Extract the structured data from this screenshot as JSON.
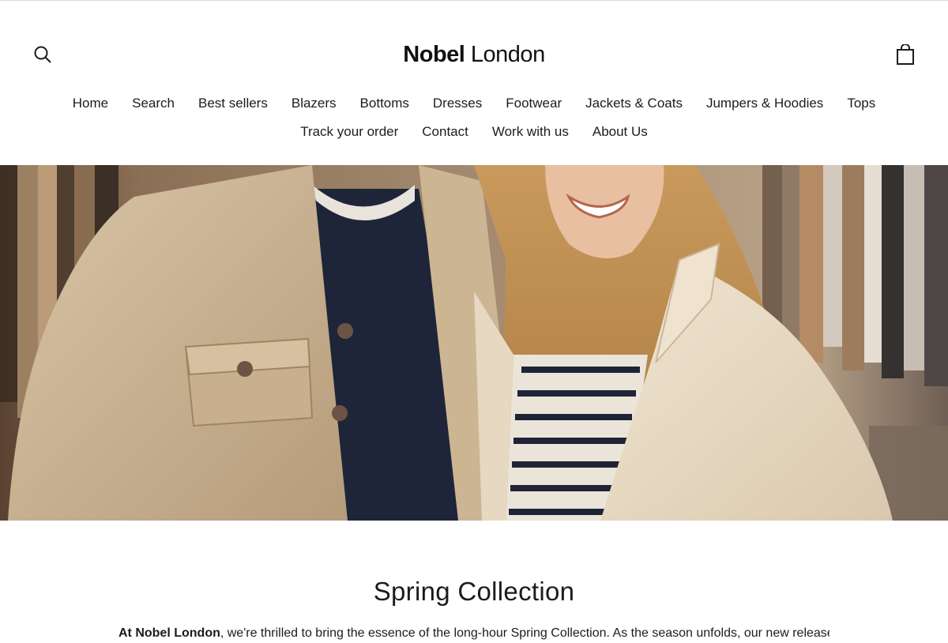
{
  "brand": {
    "name_bold": "Nobel",
    "name_light": "London"
  },
  "header": {
    "search_icon": "search-icon",
    "cart_icon": "shopping-bag-icon"
  },
  "nav": {
    "row1": [
      "Home",
      "Search",
      "Best sellers",
      "Blazers",
      "Bottoms",
      "Dresses",
      "Footwear",
      "Jackets & Coats",
      "Jumpers & Hoodies",
      "Tops"
    ],
    "row2": [
      "Track your order",
      "Contact",
      "Work with us",
      "About Us"
    ]
  },
  "collection": {
    "title": "Spring Collection",
    "intro_bold": "At Nobel London",
    "intro_rest": ", we're thrilled to bring the essence of the long-hour Spring Collection. As the season unfolds, our new releases"
  },
  "colors": {
    "text": "#1c1c1c",
    "background": "#ffffff"
  }
}
